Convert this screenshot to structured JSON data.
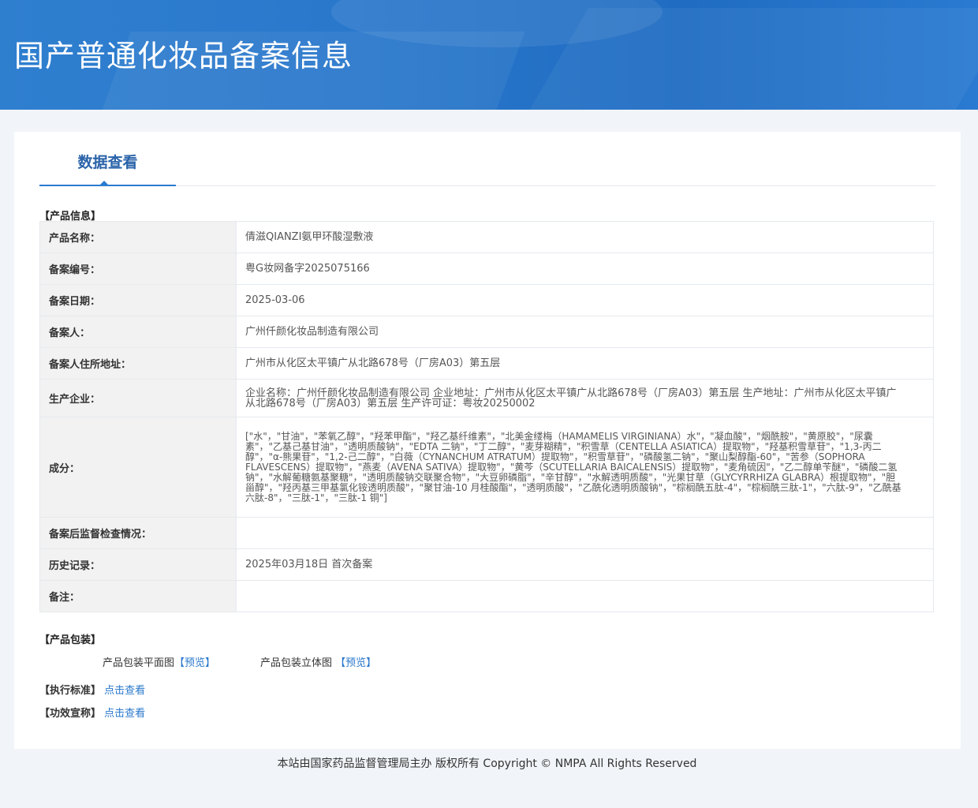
{
  "banner": {
    "title": "国产普通化妆品备案信息"
  },
  "tabs": [
    {
      "label": "数据查看"
    }
  ],
  "product_info": {
    "section_title": "【产品信息】",
    "rows": [
      {
        "label": "产品名称：",
        "value": "倩滋QIANZI氨甲环酸湿敷液"
      },
      {
        "label": "备案编号：",
        "value": "粤G妆网备字2025075166"
      },
      {
        "label": "备案日期：",
        "value": "2025-03-06"
      },
      {
        "label": "备案人：",
        "value": "广州仟颜化妆品制造有限公司"
      },
      {
        "label": "备案人住所地址：",
        "value": "广州市从化区太平镇广从北路678号（厂房A03）第五层"
      },
      {
        "label": "生产企业：",
        "value": "企业名称：广州仟颜化妆品制造有限公司 企业地址：广州市从化区太平镇广从北路678号（厂房A03）第五层 生产地址：广州市从化区太平镇广从北路678号（厂房A03）第五层 生产许可证：粤妆20250002"
      },
      {
        "label": "成分：",
        "value": "[\"水\"，\"甘油\"，\"苯氧乙醇\"，\"羟苯甲酯\"，\"羟乙基纤维素\"，\"北美金缕梅（HAMAMELIS VIRGINIANA）水\"，\"凝血酸\"，\"烟酰胺\"，\"黄原胶\"，\"尿囊素\"，\"乙基己基甘油\"，\"透明质酸钠\"，\"EDTA 二钠\"，\"丁二醇\"，\"麦芽糊精\"，\"积雪草（CENTELLA ASIATICA）提取物\"，\"羟基积雪草苷\"，\"1,3-丙二醇\"，\"α-熊果苷\"，\"1,2-己二醇\"，\"白薇（CYNANCHUM ATRATUM）提取物\"，\"积雪草苷\"，\"磷酸氢二钠\"，\"聚山梨醇酯-60\"，\"苦参（SOPHORA FLAVESCENS）提取物\"，\"燕麦（AVENA SATIVA）提取物\"，\"黄芩（SCUTELLARIA BAICALENSIS）提取物\"，\"麦角硫因\"，\"乙二醇单苄醚\"，\"磷酸二氢钠\"，\"水解葡糖氨基聚糖\"，\"透明质酸钠交联聚合物\"，\"大豆卵磷脂\"，\"辛甘醇\"，\"水解透明质酸\"，\"光果甘草（GLYCYRRHIZA GLABRA）根提取物\"，\"胆甾醇\"，\"羟丙基三甲基氯化铵透明质酸\"，\"聚甘油-10 月桂酸酯\"，\"透明质酸\"，\"乙酰化透明质酸钠\"，\"棕榈酰五肽-4\"，\"棕榈酰三肽-1\"，\"六肽-9\"，\"乙酰基六肽-8\"，\"三肽-1\"，\"三肽-1 铜\"]"
      },
      {
        "label": "备案后监督检查情况：",
        "value": ""
      },
      {
        "label": "历史记录：",
        "value": "2025年03月18日 首次备案"
      },
      {
        "label": "备注：",
        "value": ""
      }
    ]
  },
  "packaging": {
    "section_title": "【产品包装】",
    "flat_label": "产品包装平面图",
    "flat_link": "【预览】",
    "stereo_label": "产品包装立体图",
    "stereo_link": "【预览】"
  },
  "standard": {
    "label": "【执行标准】",
    "link": "点击查看"
  },
  "efficacy": {
    "label": "【功效宣称】",
    "link": "点击查看"
  },
  "footer": {
    "text": "本站由国家药品监督管理局主办 版权所有 Copyright © NMPA All Rights Reserved"
  }
}
